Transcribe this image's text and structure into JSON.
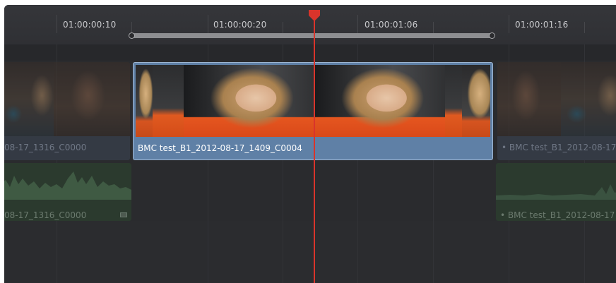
{
  "ruler": {
    "timecodes": [
      "01:00:00:10",
      "01:00:00:20",
      "01:00:01:06",
      "01:00:01:16"
    ]
  },
  "video_track": {
    "clips": [
      {
        "name": "08-17_1316_C0000"
      },
      {
        "name": "BMC test_B1_2012-08-17_1409_C0004"
      },
      {
        "name": "• BMC test_B1_2012-08-17"
      }
    ]
  },
  "audio_track": {
    "clips": [
      {
        "name": "08-17_1316_C0000"
      },
      {
        "name": "• BMC test_B1_2012-08-17"
      }
    ]
  },
  "colors": {
    "playhead": "#d9342b",
    "selected_clip": "#5f80a6",
    "audio_clip": "#2b3a2e"
  }
}
